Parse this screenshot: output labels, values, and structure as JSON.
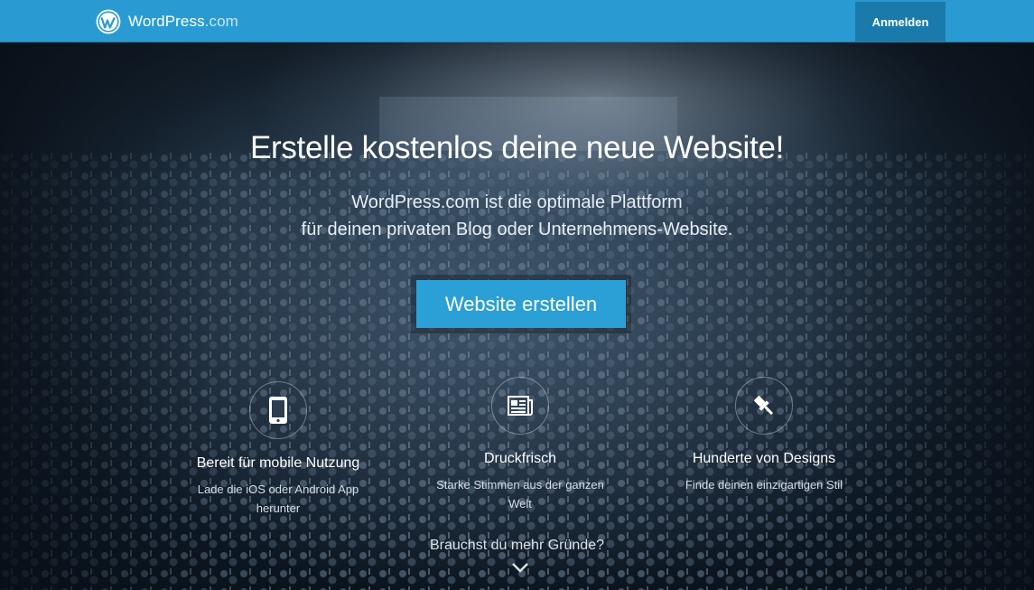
{
  "topbar": {
    "brand_name": "WordPress",
    "brand_suffix": ".com",
    "login_label": "Anmelden",
    "logo_icon": "wordpress-logo-icon"
  },
  "hero": {
    "headline": "Erstelle kostenlos deine neue Website!",
    "subline_1": "WordPress.com ist die optimale Plattform",
    "subline_2": "für deinen privaten Blog oder Unternehmens-Website.",
    "cta_label": "Website erstellen"
  },
  "features": [
    {
      "icon": "smartphone-icon",
      "title": "Bereit für mobile Nutzung",
      "desc_1": "Lade die iOS oder Android App",
      "desc_2": "herunter"
    },
    {
      "icon": "newspaper-icon",
      "title": "Druckfrisch",
      "desc_1": "Starke Stimmen aus der ganzen",
      "desc_2": "Welt"
    },
    {
      "icon": "paintbrush-icon",
      "title": "Hunderte von Designs",
      "desc_1": "Finde deinen einzigartigen Stil",
      "desc_2": ""
    }
  ],
  "more": {
    "label": "Brauchst du mehr Gründe?",
    "icon": "chevron-down-icon"
  },
  "colors": {
    "topbar": "#2a9bd2",
    "login_button": "#1a7aab",
    "cta": "#2aa0d6"
  }
}
